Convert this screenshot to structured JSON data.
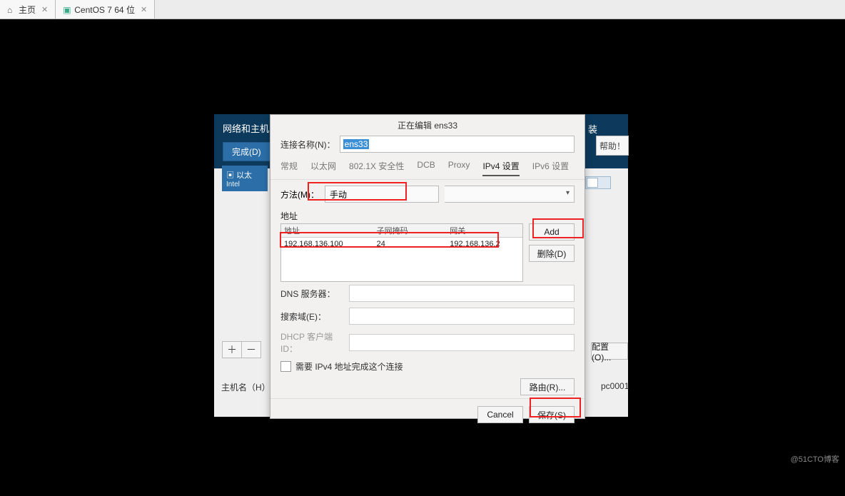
{
  "tabbar": {
    "home_label": "主页",
    "vm_label": "CentOS 7 64 位"
  },
  "anaconda": {
    "title": "网络和主机",
    "done_btn": "完成(D)",
    "help_btn": "帮助！",
    "zhuang": "装",
    "iface_top": "以太",
    "iface_sub": "Intel",
    "plus": "＋",
    "minus": "－",
    "hostname_label": "主机名（H）",
    "hostname_value": "pc0001",
    "config_btn": "配置(O)..."
  },
  "dialog": {
    "title": "正在编辑 ens33",
    "conn_name_label": "连接名称(N)：",
    "conn_name_value": "ens33",
    "tabs": {
      "general": "常规",
      "ethernet": "以太网",
      "sec": "802.1X 安全性",
      "dcb": "DCB",
      "proxy": "Proxy",
      "ipv4": "IPv4 设置",
      "ipv6": "IPv6 设置"
    },
    "method_label": "方法(M)：",
    "method_value": "手动",
    "addr_section": "地址",
    "addr_headers": {
      "addr": "地址",
      "mask": "子网掩码",
      "gw": "网关"
    },
    "addr_row": {
      "addr": "192.168.136.100",
      "mask": "24",
      "gw": "192.168.136.2"
    },
    "add_btn": "Add",
    "del_btn": "删除(D)",
    "dns_label": "DNS 服务器：",
    "search_label": "搜索域(E)：",
    "dhcp_label": "DHCP 客户端 ID：",
    "cb_label": "需要 IPv4 地址完成这个连接",
    "route_btn": "路由(R)...",
    "cancel_btn": "Cancel",
    "save_btn": "保存(S)"
  },
  "watermark": "@51CTO博客"
}
